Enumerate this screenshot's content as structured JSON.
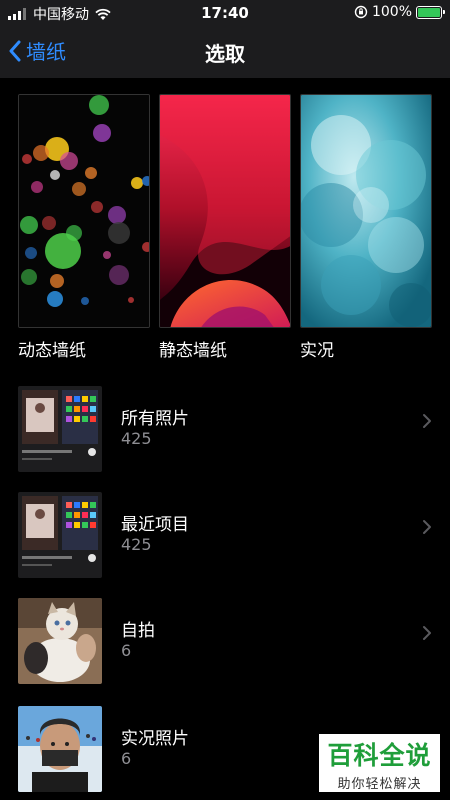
{
  "status_bar": {
    "carrier": "中国移动",
    "time": "17:40",
    "battery": "100%",
    "battery_level": 1.0,
    "icons": [
      "signal-icon",
      "wifi-icon",
      "orientation-lock-icon",
      "battery-icon"
    ]
  },
  "nav": {
    "back_label": "墙纸",
    "title": "选取",
    "accent_color": "#2f8cff"
  },
  "categories": [
    {
      "label": "动态墙纸"
    },
    {
      "label": "静态墙纸"
    },
    {
      "label": "实况"
    }
  ],
  "albums": [
    {
      "name": "所有照片",
      "count": "425"
    },
    {
      "name": "最近项目",
      "count": "425"
    },
    {
      "name": "自拍",
      "count": "6"
    },
    {
      "name": "实况照片",
      "count": "6"
    }
  ],
  "watermark": {
    "main": "百科全说",
    "sub": "助你轻松解决",
    "color": "#1f9e3a"
  }
}
